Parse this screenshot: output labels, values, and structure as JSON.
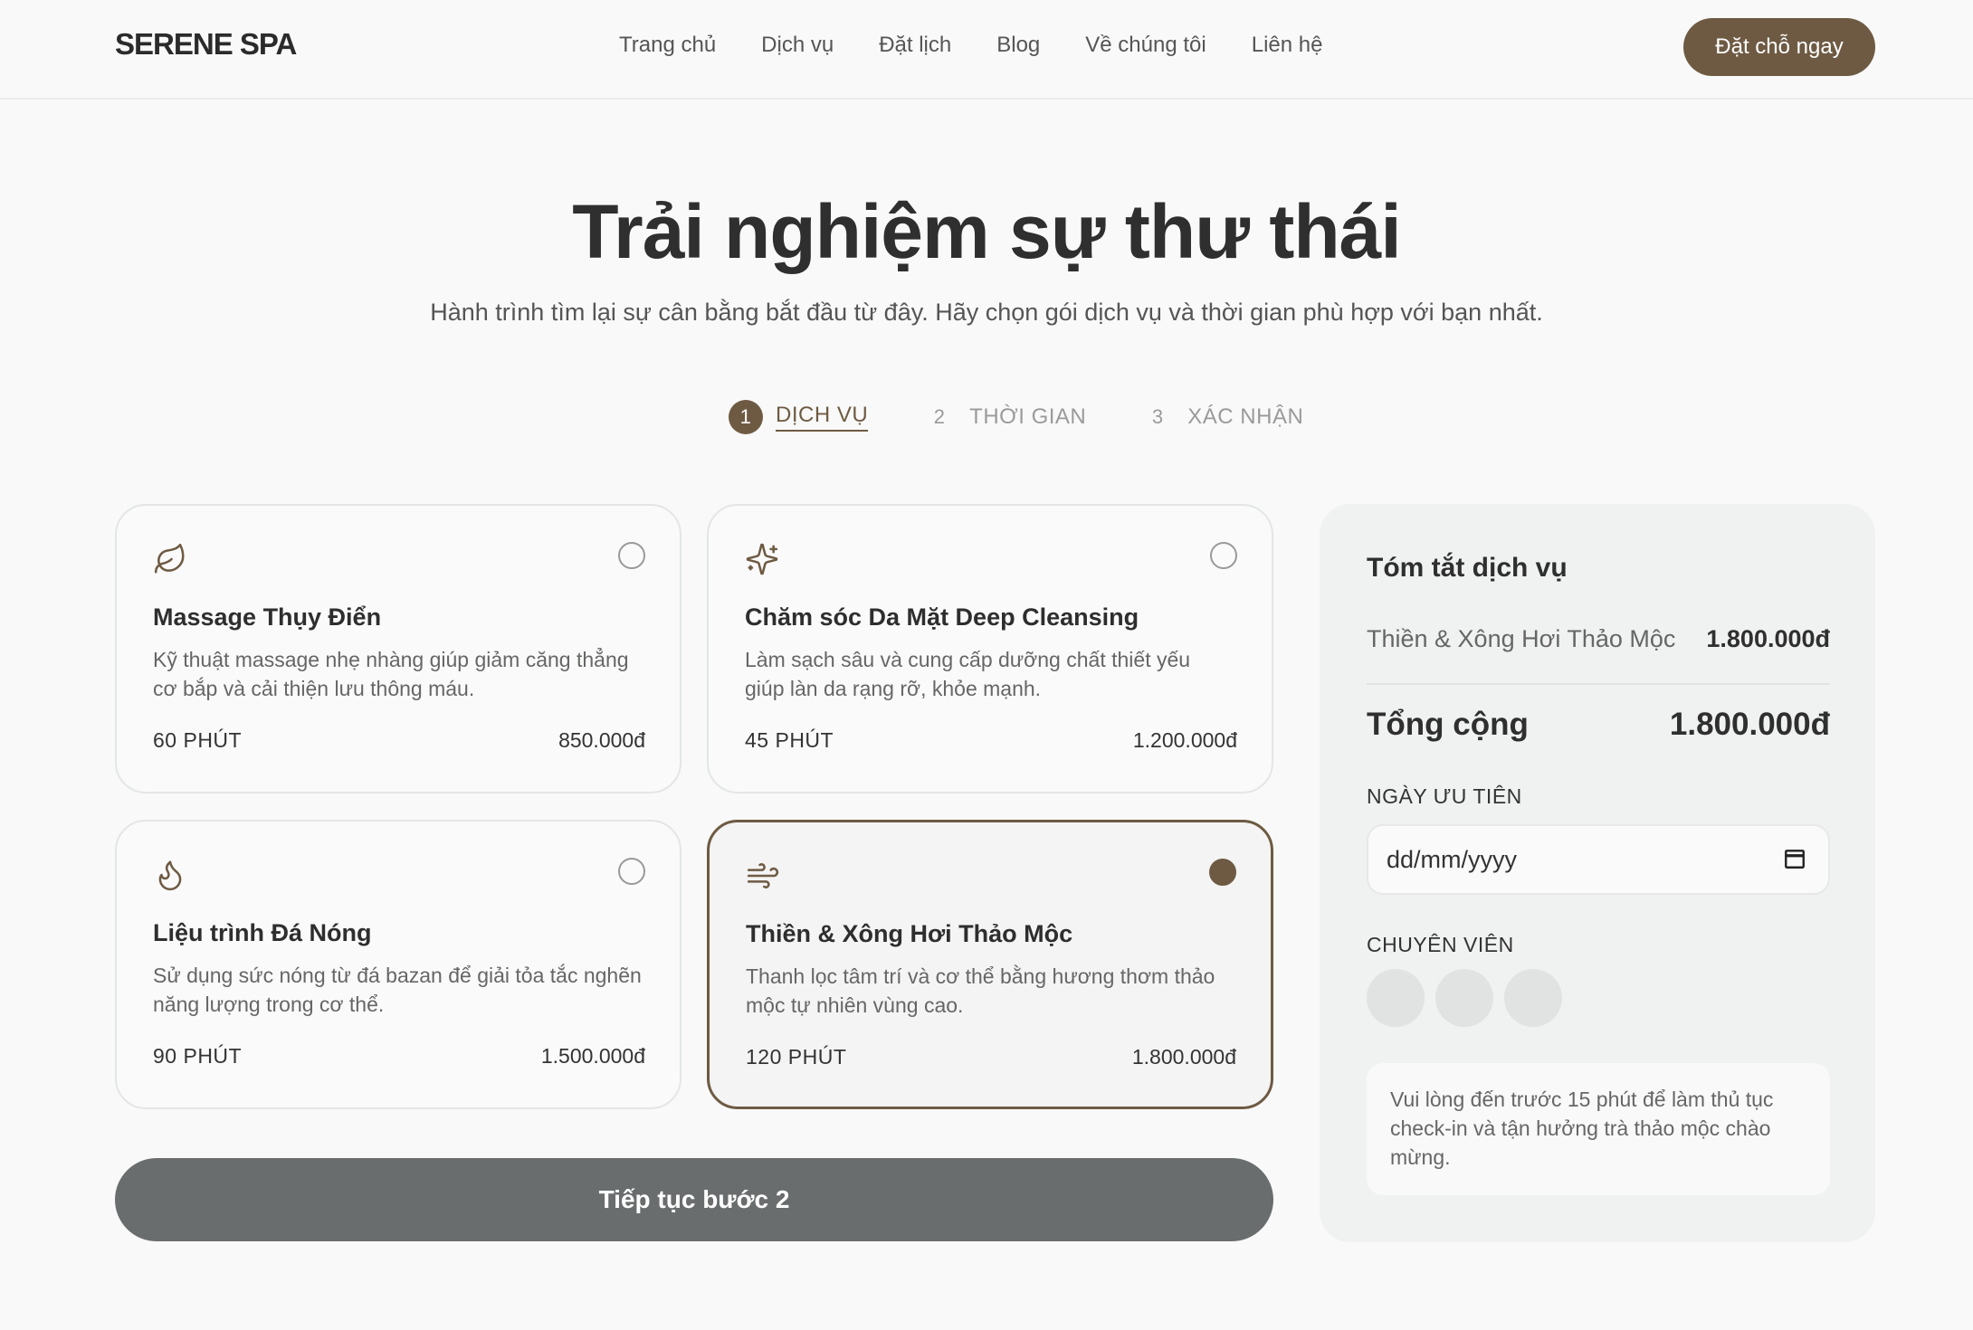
{
  "brand": "SERENE SPA",
  "nav": {
    "items": [
      "Trang chủ",
      "Dịch vụ",
      "Đặt lịch",
      "Blog",
      "Về chúng tôi",
      "Liên hệ"
    ],
    "cta": "Đặt chỗ ngay"
  },
  "hero": {
    "title": "Trải nghiệm sự thư thái",
    "subtitle": "Hành trình tìm lại sự cân bằng bắt đầu từ đây. Hãy chọn gói dịch vụ và thời gian phù hợp với bạn nhất."
  },
  "steps": [
    {
      "num": "1",
      "label": "DỊCH VỤ",
      "active": true
    },
    {
      "num": "2",
      "label": "THỜI GIAN",
      "active": false
    },
    {
      "num": "3",
      "label": "XÁC NHẬN",
      "active": false
    }
  ],
  "services": [
    {
      "icon": "leaf-icon",
      "title": "Massage Thụy Điển",
      "desc": "Kỹ thuật massage nhẹ nhàng giúp giảm căng thẳng cơ bắp và cải thiện lưu thông máu.",
      "duration": "60 PHÚT",
      "price": "850.000đ",
      "selected": false
    },
    {
      "icon": "sparkles-icon",
      "title": "Chăm sóc Da Mặt Deep Cleansing",
      "desc": "Làm sạch sâu và cung cấp dưỡng chất thiết yếu giúp làn da rạng rỡ, khỏe mạnh.",
      "duration": "45 PHÚT",
      "price": "1.200.000đ",
      "selected": false
    },
    {
      "icon": "flame-icon",
      "title": "Liệu trình Đá Nóng",
      "desc": "Sử dụng sức nóng từ đá bazan để giải tỏa tắc nghẽn năng lượng trong cơ thể.",
      "duration": "90 PHÚT",
      "price": "1.500.000đ",
      "selected": false
    },
    {
      "icon": "wind-icon",
      "title": "Thiền & Xông Hơi Thảo Mộc",
      "desc": "Thanh lọc tâm trí và cơ thể bằng hương thơm thảo mộc tự nhiên vùng cao.",
      "duration": "120 PHÚT",
      "price": "1.800.000đ",
      "selected": true
    }
  ],
  "continue_label": "Tiếp tục bước 2",
  "summary": {
    "title": "Tóm tắt dịch vụ",
    "item_name": "Thiền & Xông Hơi Thảo Mộc",
    "item_price": "1.800.000đ",
    "total_label": "Tổng cộng",
    "total_value": "1.800.000đ",
    "date_label": "NGÀY ƯU TIÊN",
    "date_placeholder": "dd/mm/yyyy",
    "staff_label": "CHUYÊN VIÊN",
    "note": "Vui lòng đến trước 15 phút để làm thủ tục check-in và tận hưởng trà thảo mộc chào mừng."
  },
  "colors": {
    "accent": "#6e5a43",
    "button_gray": "#6a6d6e"
  }
}
